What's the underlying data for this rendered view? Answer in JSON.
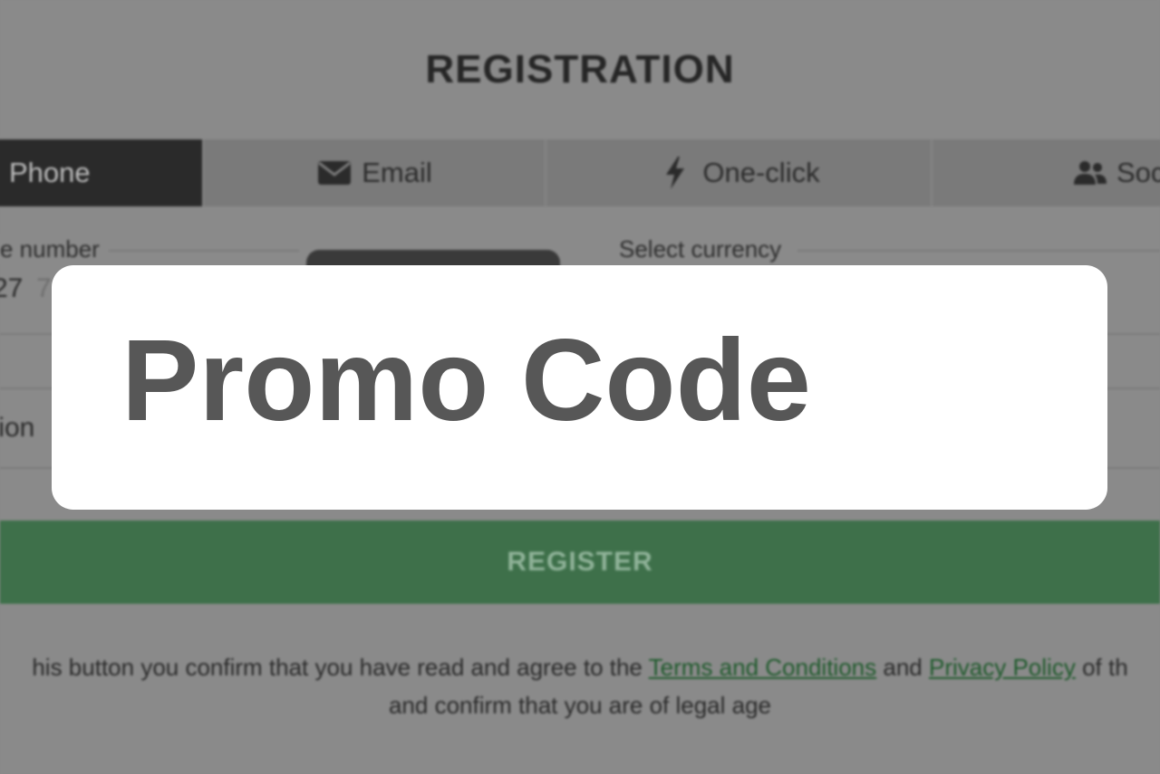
{
  "page": {
    "title": "REGISTRATION"
  },
  "tabs": [
    {
      "label": "Phone",
      "icon": "phone-icon",
      "active": true
    },
    {
      "label": "Email",
      "icon": "envelope-icon",
      "active": false
    },
    {
      "label": "One-click",
      "icon": "lightning-icon",
      "active": false
    },
    {
      "label": "Socia",
      "icon": "users-icon",
      "active": false
    }
  ],
  "form": {
    "phone_legend": "e number",
    "phone_value": "27",
    "phone_placeholder": "7",
    "currency_legend": "Select currency",
    "side_text": "tion"
  },
  "register_button": {
    "label": "REGISTER",
    "color": "#3e704a"
  },
  "terms": {
    "prefix": "his button you confirm that you have read and agree to the",
    "terms_link": "Terms and Conditions",
    "and": "and",
    "privacy_link": "Privacy Policy",
    "suffix": "of th",
    "line2": "and confirm that you are of legal age"
  },
  "modal": {
    "title": "Promo Code"
  }
}
